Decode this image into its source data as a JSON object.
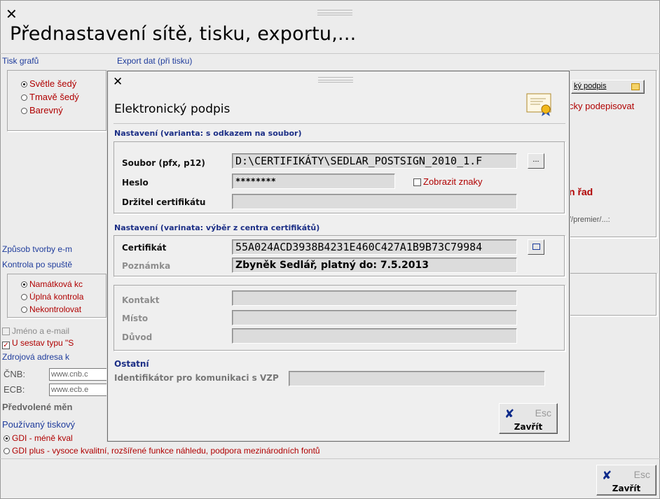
{
  "main": {
    "title": "Přednastavení sítě, tisku, exportu,...",
    "close_symbol": "✕",
    "sections": {
      "tisk_grafu": "Tisk grafů",
      "export_dat": "Export dat (při tisku)",
      "zpusob_tvorby": "Způsob tvorby e-m",
      "kontrola": "Kontrola po spuště",
      "zdrojova": "Zdrojová adresa k",
      "predvolene": "Předvolené měn",
      "pouzivany": "Používaný tiskový"
    },
    "graph_options": [
      "Světle šedý",
      "Tmavě šedý",
      "Barevný"
    ],
    "graph_selected": 0,
    "kontrola_options": [
      "Namátková kc",
      "Úplná kontrola",
      "Nekontrolovat"
    ],
    "kontrola_selected": 0,
    "checks": [
      {
        "label": "Jméno a e-mail",
        "checked": false,
        "disabled": true
      },
      {
        "label": "U sestav typu \"S",
        "checked": true,
        "disabled": false
      }
    ],
    "sources": [
      {
        "label": "ČNB:",
        "value": "www.cnb.c"
      },
      {
        "label": "ECB:",
        "value": "www.ecb.e"
      }
    ],
    "print_options": [
      "GDI - méně kval",
      "GDI plus - vysoce kvalitní, rozšířené funkce náhledu, podpora mezinárodních fontů"
    ],
    "print_selected": 0,
    "right_partial": {
      "podpis_btn": "ký podpis",
      "podepisovat": "cky podepisovat",
      "rad": "n řad",
      "premier": "//premier/...:"
    },
    "close_button": {
      "esc": "Esc",
      "label": "Zavřít"
    }
  },
  "dialog": {
    "title": "Elektronický podpis",
    "close_symbol": "✕",
    "section1": "Nastavení (varianta: s odkazem na soubor)",
    "soubor_label": "Soubor (pfx, p12)",
    "soubor_value": "D:\\CERTIFIKÁTY\\SEDLAR_POSTSIGN_2010_1.F",
    "browse_label": "...",
    "heslo_label": "Heslo",
    "heslo_value": "********",
    "zobrazit_label": "Zobrazit znaky",
    "zobrazit_checked": false,
    "drzitel_label": "Držitel certifikátu",
    "drzitel_value": "",
    "section2": "Nastavení (varinata: výběr z centra certifikátů)",
    "certifikat_label": "Certifikát",
    "certifikat_value": "55A024ACD3938B4231E460C427A1B9B73C79984",
    "poznamka_label": "Poznámka",
    "poznamka_value": "Zbyněk Sedlář, platný do: 7.5.2013",
    "kontakt_label": "Kontakt",
    "misto_label": "Místo",
    "duvod_label": "Důvod",
    "ostatni_label": "Ostatní",
    "identifikator_label": "Identifikátor pro komunikaci s VZP",
    "close_button": {
      "esc": "Esc",
      "label": "Zavřít"
    }
  },
  "colors": {
    "accent_blue": "#1f3c9c",
    "accent_red": "#b00000",
    "section_blue": "#1c2f86"
  }
}
